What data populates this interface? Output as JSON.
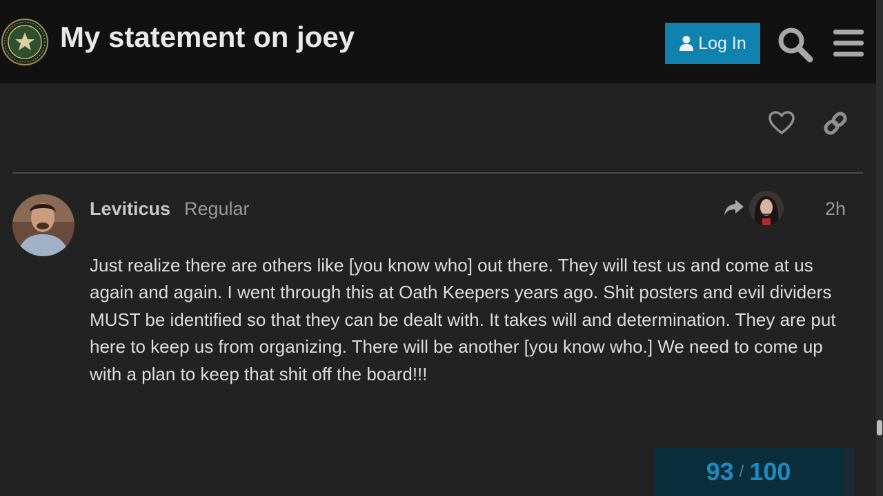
{
  "header": {
    "logo_text": "INFOWARS ARMY",
    "title": "My statement on joey",
    "login_label": "Log In",
    "icons": {
      "user": "user-icon",
      "search": "search-icon",
      "menu": "hamburger-menu-icon"
    },
    "accent_color": "#0f82af"
  },
  "previous_post_actions": {
    "like_icon": "heart-icon",
    "link_icon": "link-icon"
  },
  "post": {
    "username": "Leviticus",
    "user_title": "Regular",
    "reply_icon": "reply-arrow-icon",
    "date": "2h",
    "body": "Just realize there are others like [you know who] out there. They will test us and come at us again and again. I went through this at Oath Keepers years ago. Shit posters and evil dividers MUST be identified so that they can be dealt with. It takes will and determination. They are put here to keep us from organizing. There will be another [you know who.] We need to come up with a plan to keep that shit off the board!!!"
  },
  "progress": {
    "current": "93",
    "separator": "/",
    "total": "100"
  }
}
